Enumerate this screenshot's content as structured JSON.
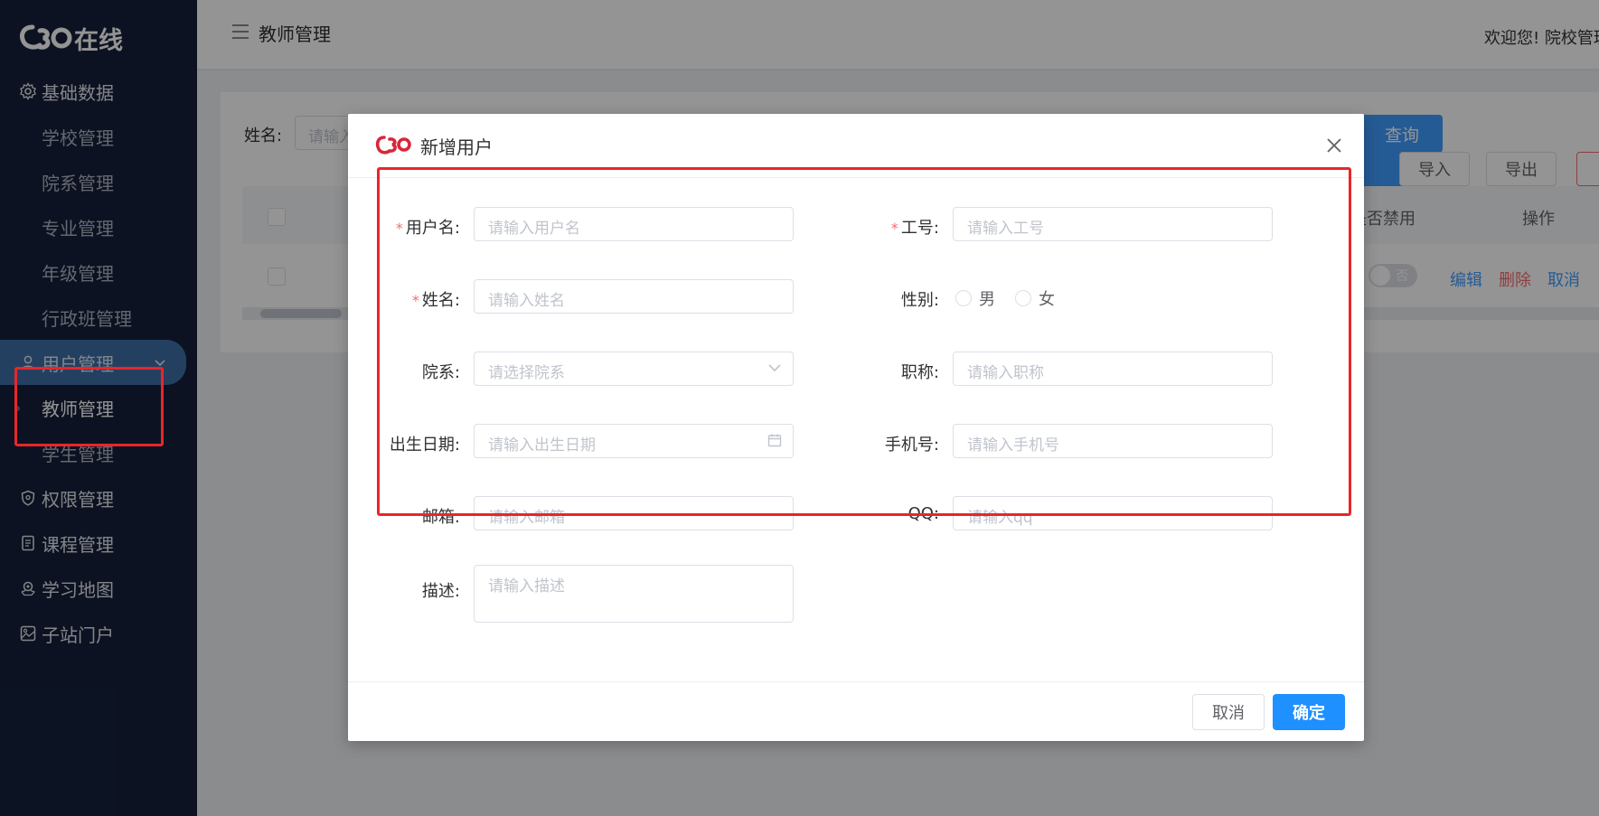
{
  "app": {
    "brand": "在线"
  },
  "sidebar": {
    "groups": [
      {
        "label": "基础数据",
        "icon": "gear-icon"
      },
      {
        "label": "用户管理",
        "icon": "user-icon"
      },
      {
        "label": "权限管理",
        "icon": "shield-icon"
      },
      {
        "label": "课程管理",
        "icon": "book-icon"
      },
      {
        "label": "学习地图",
        "icon": "map-icon"
      },
      {
        "label": "子站门户",
        "icon": "image-icon"
      }
    ],
    "basic_items": [
      "学校管理",
      "院系管理",
      "专业管理",
      "年级管理",
      "行政班管理"
    ],
    "user_items": [
      "教师管理",
      "学生管理"
    ]
  },
  "topbar": {
    "title": "教师管理",
    "welcome": "欢迎您! 院校管理"
  },
  "list": {
    "filter_label": "姓名:",
    "filter_placeholder": "请输入",
    "query_label": "查询",
    "import_label": "导入",
    "export_label": "导出",
    "col_disabled": "是否禁用",
    "col_actions": "操作",
    "row": {
      "switch_text": "否",
      "edit": "编辑",
      "delete": "删除",
      "cancel": "取消"
    }
  },
  "dialog": {
    "title": "新增用户",
    "fields": {
      "username": {
        "label": "用户名:",
        "placeholder": "请输入用户名",
        "required": "*"
      },
      "job_no": {
        "label": "工号:",
        "placeholder": "请输入工号",
        "required": "*"
      },
      "name": {
        "label": "姓名:",
        "placeholder": "请输入姓名",
        "required": "*"
      },
      "gender": {
        "label": "性别:",
        "options": [
          "男",
          "女"
        ]
      },
      "department": {
        "label": "院系:",
        "placeholder": "请选择院系"
      },
      "title": {
        "label": "职称:",
        "placeholder": "请输入职称"
      },
      "birthday": {
        "label": "出生日期:",
        "placeholder": "请输入出生日期"
      },
      "phone": {
        "label": "手机号:",
        "placeholder": "请输入手机号"
      },
      "email": {
        "label": "邮箱:",
        "placeholder": "请输入邮箱"
      },
      "qq": {
        "label": "QQ:",
        "placeholder": "请输入qq"
      },
      "description": {
        "label": "描述:",
        "placeholder": "请输入描述"
      }
    },
    "cancel_label": "取消",
    "confirm_label": "确定"
  },
  "colors": {
    "sidebar_bg": "#15203a",
    "primary": "#409eff",
    "danger": "#f56c6c",
    "annotation": "#e8262a"
  }
}
